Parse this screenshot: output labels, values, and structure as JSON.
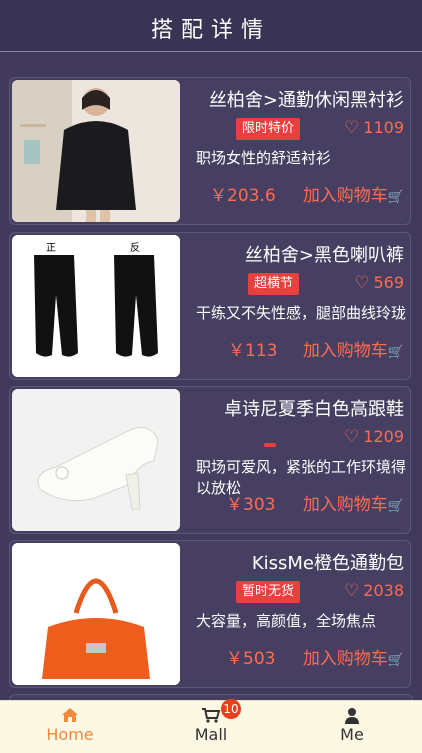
{
  "header": {
    "title": "搭配详情"
  },
  "products": [
    {
      "name": "丝柏舍>通勤休闲黑衬衫",
      "tag": "限时特价",
      "likes": "1109",
      "description": "职场女性的舒适衬衫",
      "price": "￥203.6",
      "cart_label": "加入购物车"
    },
    {
      "name": "丝柏舍>黑色喇叭裤",
      "tag": "超横节",
      "likes": "569",
      "description": "干练又不失性感，腿部曲线玲珑",
      "price": "￥113",
      "cart_label": "加入购物车",
      "image_labels": {
        "front": "正",
        "back": "反"
      }
    },
    {
      "name": "卓诗尼夏季白色高跟鞋",
      "tag": "",
      "likes": "1209",
      "description": "职场可爱风，紧张的工作环境得以放松",
      "price": "￥303",
      "cart_label": "加入购物车"
    },
    {
      "name": "KissMe橙色通勤包",
      "tag": "暂时无货",
      "likes": "2038",
      "description": "大容量，高颜值，全场焦点",
      "price": "￥503",
      "cart_label": "加入购物车"
    }
  ],
  "tabbar": {
    "home": {
      "label": "Home",
      "icon": "home-icon"
    },
    "mall": {
      "label": "Mall",
      "icon": "cart-icon",
      "badge": "10"
    },
    "me": {
      "label": "Me",
      "icon": "user-icon"
    }
  },
  "colors": {
    "accent": "#ff6b52",
    "tag_red": "#e8403f",
    "tab_active": "#f08a3c",
    "background": "#3f3858"
  }
}
